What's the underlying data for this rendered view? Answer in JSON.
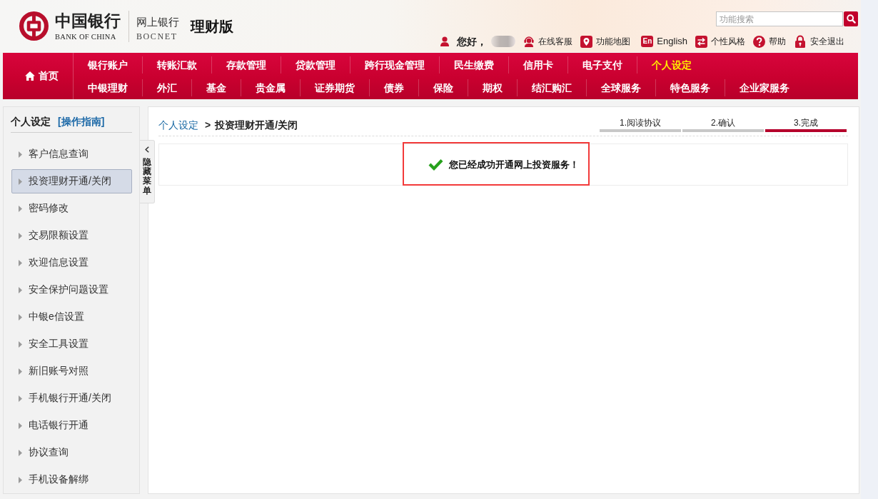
{
  "header": {
    "logo": {
      "name_cn": "中国银行",
      "name_en": "BANK OF CHINA"
    },
    "product": {
      "name_cn": "网上银行",
      "name_en": "BOCNET"
    },
    "edition": "理财版",
    "search": {
      "placeholder": "功能搜索"
    },
    "greeting": "您好，",
    "links": [
      {
        "kind": "service",
        "label": "在线客服"
      },
      {
        "kind": "map",
        "label": "功能地图"
      },
      {
        "kind": "language",
        "icon_text": "En",
        "label": "English"
      },
      {
        "kind": "style",
        "label": "个性风格"
      },
      {
        "kind": "help",
        "label": "帮助"
      },
      {
        "kind": "logout",
        "label": "安全退出"
      }
    ]
  },
  "nav": {
    "home": {
      "label": "首页",
      "selected": false
    },
    "rows": [
      {
        "items": [
          {
            "label": "银行账户",
            "selected": false
          },
          {
            "label": "转账汇款",
            "selected": false
          },
          {
            "label": "存款管理",
            "selected": false
          },
          {
            "label": "贷款管理",
            "selected": false
          },
          {
            "label": "跨行现金管理",
            "selected": false
          },
          {
            "label": "民生缴费",
            "selected": false
          },
          {
            "label": "信用卡",
            "selected": false
          },
          {
            "label": "电子支付",
            "selected": false
          },
          {
            "label": "个人设定",
            "selected": true
          }
        ]
      },
      {
        "items": [
          {
            "label": "中银理财",
            "selected": false
          },
          {
            "label": "外汇",
            "selected": false
          },
          {
            "label": "基金",
            "selected": false
          },
          {
            "label": "贵金属",
            "selected": false
          },
          {
            "label": "证券期货",
            "selected": false
          },
          {
            "label": "债券",
            "selected": false
          },
          {
            "label": "保险",
            "selected": false
          },
          {
            "label": "期权",
            "selected": false
          },
          {
            "label": "结汇购汇",
            "selected": false
          },
          {
            "label": "全球服务",
            "selected": false
          },
          {
            "label": "特色服务",
            "selected": false
          },
          {
            "label": "企业家服务",
            "selected": false
          }
        ]
      }
    ]
  },
  "sidebar": {
    "title": "个人设定",
    "guide_link": "[操作指南]",
    "items": [
      {
        "label": "客户信息查询",
        "selected": false
      },
      {
        "label": "投资理财开通/关闭",
        "selected": true
      },
      {
        "label": "密码修改",
        "selected": false
      },
      {
        "label": "交易限额设置",
        "selected": false
      },
      {
        "label": "欢迎信息设置",
        "selected": false
      },
      {
        "label": "安全保护问题设置",
        "selected": false
      },
      {
        "label": "中银e信设置",
        "selected": false
      },
      {
        "label": "安全工具设置",
        "selected": false
      },
      {
        "label": "新旧账号对照",
        "selected": false
      },
      {
        "label": "手机银行开通/关闭",
        "selected": false
      },
      {
        "label": "电话银行开通",
        "selected": false
      },
      {
        "label": "协议查询",
        "selected": false
      },
      {
        "label": "手机设备解绑",
        "selected": false
      }
    ],
    "collapse_tab": {
      "label": "隐藏菜单"
    }
  },
  "main": {
    "breadcrumb": {
      "parent": "个人设定",
      "separator": ">",
      "current": "投资理财开通/关闭"
    },
    "steps": [
      {
        "label": "1.阅读协议",
        "selected": false
      },
      {
        "label": "2.确认",
        "selected": false
      },
      {
        "label": "3.完成",
        "selected": true
      }
    ],
    "message": {
      "text": "您已经成功开通网上投资服务！",
      "highlighted": true
    }
  }
}
